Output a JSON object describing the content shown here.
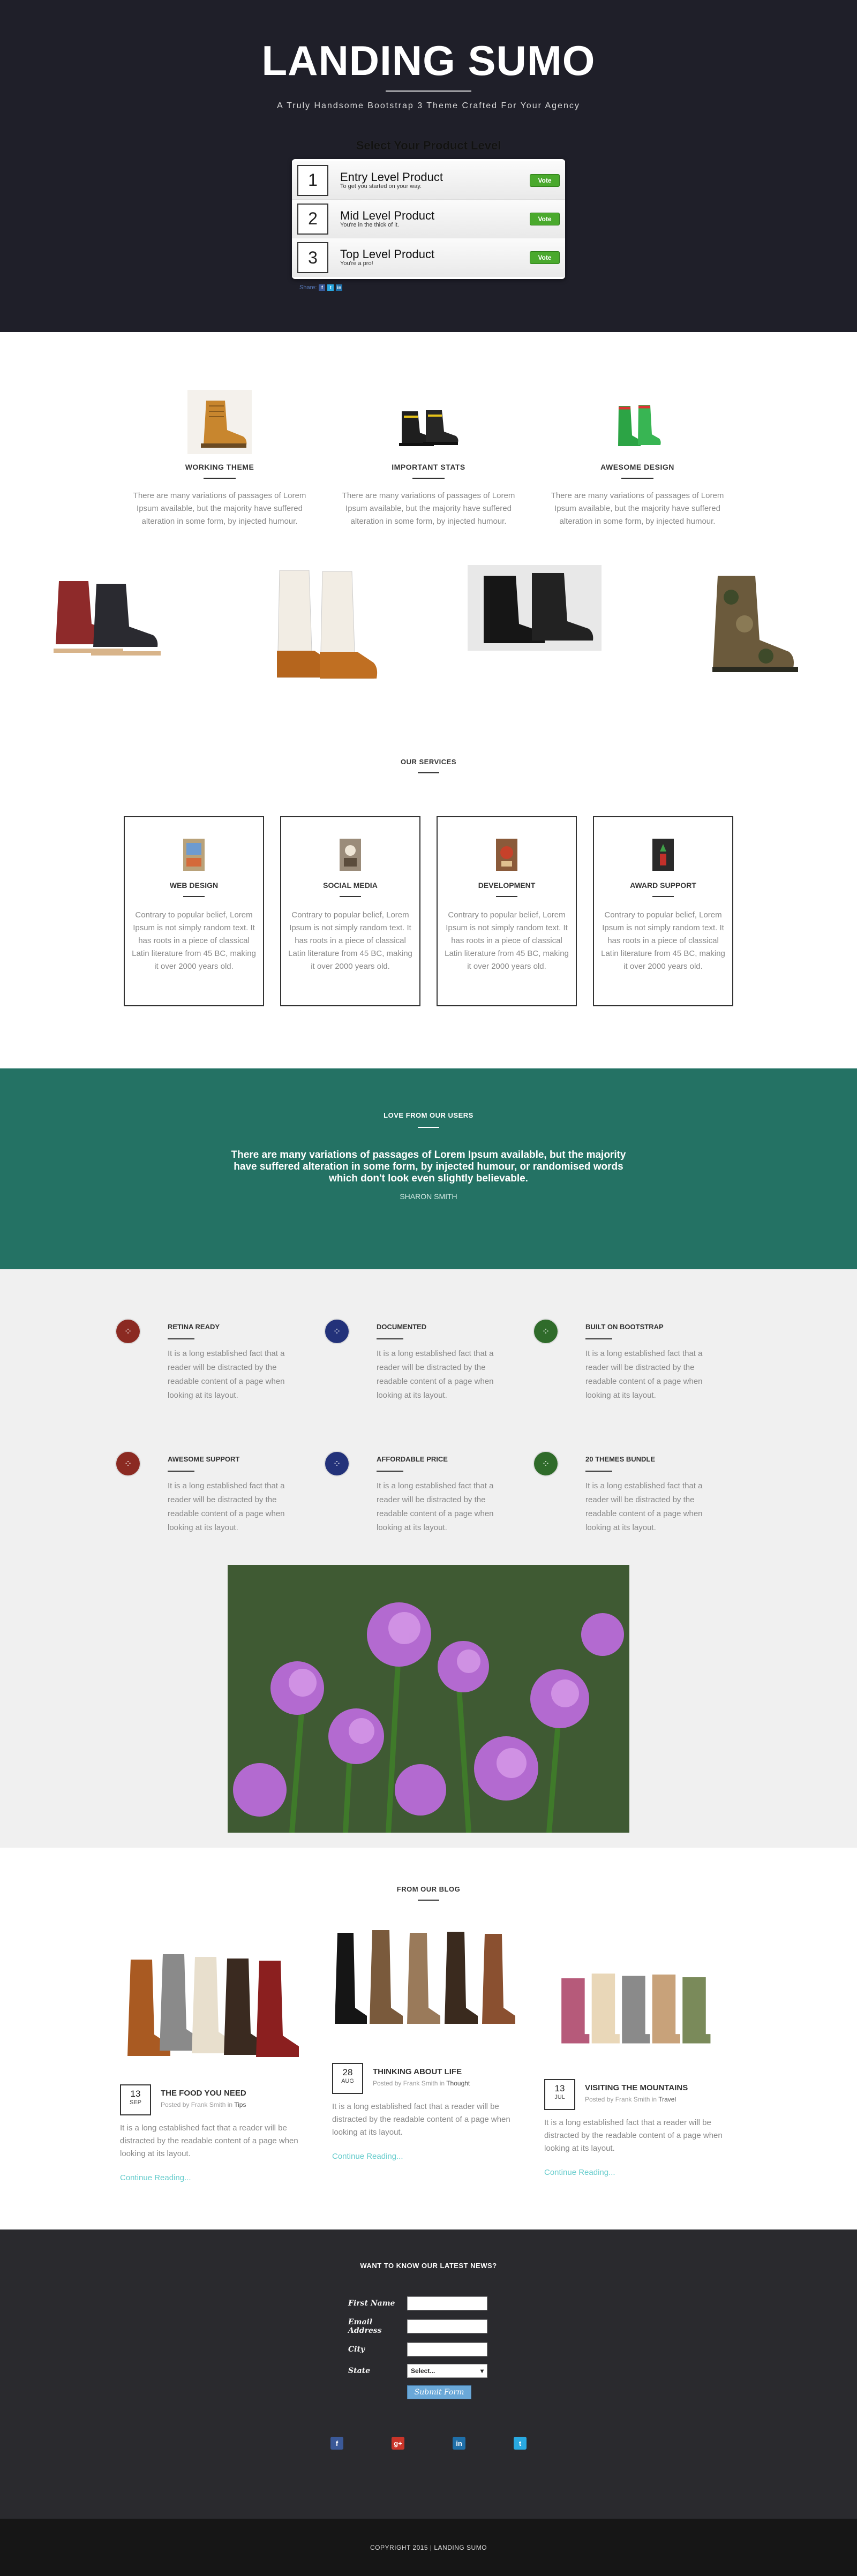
{
  "hero": {
    "title": "LANDING SUMO",
    "subtitle": "A Truly Handsome Bootstrap 3 Theme Crafted For Your Agency",
    "select_title": "Select Your Product Level",
    "products": [
      {
        "num": "1",
        "name": "Entry Level Product",
        "desc": "To get you started on your way.",
        "vote": "Vote"
      },
      {
        "num": "2",
        "name": "Mid Level Product",
        "desc": "You're in the thick of it.",
        "vote": "Vote"
      },
      {
        "num": "3",
        "name": "Top Level Product",
        "desc": "You're a pro!",
        "vote": "Vote"
      }
    ],
    "share_label": "Share:"
  },
  "features": [
    {
      "title": "WORKING THEME",
      "text": "There are many variations of passages of Lorem Ipsum available, but the majority have suffered alteration in some form, by injected humour."
    },
    {
      "title": "IMPORTANT STATS",
      "text": "There are many variations of passages of Lorem Ipsum available, but the majority have suffered alteration in some form, by injected humour."
    },
    {
      "title": "AWESOME DESIGN",
      "text": "There are many variations of passages of Lorem Ipsum available, but the majority have suffered alteration in some form, by injected humour."
    }
  ],
  "services": {
    "heading": "OUR SERVICES",
    "items": [
      {
        "title": "WEB DESIGN",
        "text": "Contrary to popular belief, Lorem Ipsum is not simply random text. It has roots in a piece of classical Latin literature from 45 BC, making it over 2000 years old."
      },
      {
        "title": "SOCIAL MEDIA",
        "text": "Contrary to popular belief, Lorem Ipsum is not simply random text. It has roots in a piece of classical Latin literature from 45 BC, making it over 2000 years old."
      },
      {
        "title": "DEVELOPMENT",
        "text": "Contrary to popular belief, Lorem Ipsum is not simply random text. It has roots in a piece of classical Latin literature from 45 BC, making it over 2000 years old."
      },
      {
        "title": "AWARD SUPPORT",
        "text": "Contrary to popular belief, Lorem Ipsum is not simply random text. It has roots in a piece of classical Latin literature from 45 BC, making it over 2000 years old."
      }
    ]
  },
  "testimonial": {
    "heading": "LOVE FROM OUR USERS",
    "quote": "There are many variations of passages of Lorem Ipsum available, but the majority have suffered alteration in some form, by injected humour, or randomised words which don't look even slightly believable.",
    "author": "SHARON SMITH"
  },
  "grid": [
    {
      "title": "RETINA READY",
      "text": "It is a long established fact that a reader will be distracted by the readable content of a page when looking at its layout.",
      "color": "#8b2a22"
    },
    {
      "title": "DOCUMENTED",
      "text": "It is a long established fact that a reader will be distracted by the readable content of a page when looking at its layout.",
      "color": "#23327a"
    },
    {
      "title": "BUILT ON BOOTSTRAP",
      "text": "It is a long established fact that a reader will be distracted by the readable content of a page when looking at its layout.",
      "color": "#2f6b2a"
    },
    {
      "title": "AWESOME SUPPORT",
      "text": "It is a long established fact that a reader will be distracted by the readable content of a page when looking at its layout.",
      "color": "#8b2a22"
    },
    {
      "title": "AFFORDABLE PRICE",
      "text": "It is a long established fact that a reader will be distracted by the readable content of a page when looking at its layout.",
      "color": "#23327a"
    },
    {
      "title": "20 THEMES BUNDLE",
      "text": "It is a long established fact that a reader will be distracted by the readable content of a page when looking at its layout.",
      "color": "#2f6b2a"
    }
  ],
  "blog": {
    "heading": "FROM OUR BLOG",
    "posts": [
      {
        "day": "13",
        "month": "SEP",
        "title": "THE FOOD YOU NEED",
        "posted_by": "Posted by",
        "author": "Frank Smith",
        "in": "in",
        "category": "Tips",
        "text": "It is a long established fact that a reader will be distracted by the readable content of a page when looking at its layout.",
        "link": "Continue Reading..."
      },
      {
        "day": "28",
        "month": "AUG",
        "title": "THINKING ABOUT LIFE",
        "posted_by": "Posted by",
        "author": "Frank Smith",
        "in": "in",
        "category": "Thought",
        "text": "It is a long established fact that a reader will be distracted by the readable content of a page when looking at its layout.",
        "link": "Continue Reading..."
      },
      {
        "day": "13",
        "month": "JUL",
        "title": "VISITING THE MOUNTAINS",
        "posted_by": "Posted by",
        "author": "Frank Smith",
        "in": "in",
        "category": "Travel",
        "text": "It is a long established fact that a reader will be distracted by the readable content of a page when looking at its layout.",
        "link": "Continue Reading..."
      }
    ]
  },
  "newsletter": {
    "heading": "WANT TO KNOW OUR LATEST NEWS?",
    "labels": {
      "first_name": "First Name",
      "email": "Email Address",
      "city": "City",
      "state": "State"
    },
    "state_value": "Select...",
    "submit": "Submit Form"
  },
  "socials": [
    {
      "icon": "facebook-icon",
      "glyph": "f",
      "color": "#3b5998"
    },
    {
      "icon": "google-plus-icon",
      "glyph": "g+",
      "color": "#c9352a"
    },
    {
      "icon": "linkedin-icon",
      "glyph": "in",
      "color": "#1f6fa8"
    },
    {
      "icon": "twitter-icon",
      "glyph": "t",
      "color": "#29a9e1"
    }
  ],
  "footer": {
    "copyright": "COPYRIGHT 2015 | LANDING SUMO"
  }
}
